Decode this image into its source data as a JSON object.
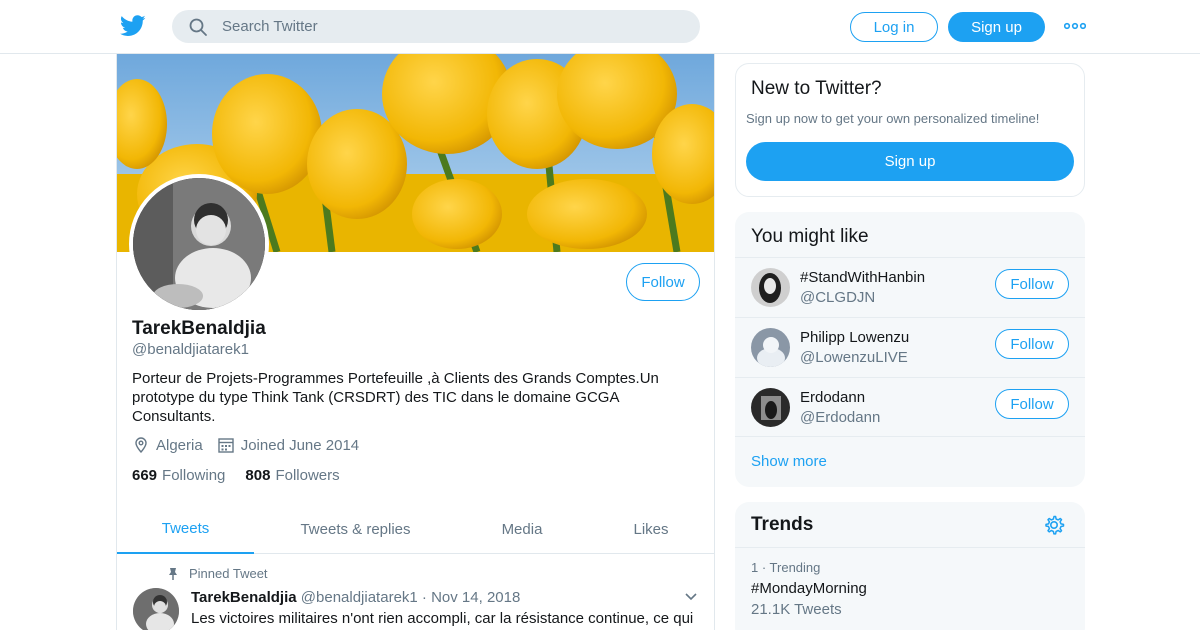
{
  "header": {
    "search_placeholder": "Search Twitter",
    "login_label": "Log in",
    "signup_label": "Sign up",
    "brand_color": "#1da1f2"
  },
  "profile": {
    "name": "TarekBenaldjia",
    "handle": "@benaldjiatarek1",
    "follow_label": "Follow",
    "bio": "Porteur de Projets-Programmes Portefeuille ,à Clients des Grands Comptes.Un prototype du type Think Tank (CRSDRT) des TIC dans le domaine GCGA Consultants.",
    "location": "Algeria",
    "joined": "Joined June 2014",
    "following_count": "669",
    "following_label": "Following",
    "followers_count": "808",
    "followers_label": "Followers",
    "tabs": [
      {
        "label": "Tweets",
        "active": true
      },
      {
        "label": "Tweets & replies",
        "active": false
      },
      {
        "label": "Media",
        "active": false
      },
      {
        "label": "Likes",
        "active": false
      }
    ]
  },
  "pinned_tweet": {
    "pinned_label": "Pinned Tweet",
    "author": "TarekBenaldjia",
    "handle": "@benaldjiatarek1",
    "separator": "·",
    "date": "Nov 14, 2018",
    "text": "Les victoires militaires n'ont rien accompli, car la résistance continue, ce qui"
  },
  "new_to_twitter": {
    "title": "New to Twitter?",
    "subtitle": "Sign up now to get your own personalized timeline!",
    "button": "Sign up"
  },
  "you_might_like": {
    "title": "You might like",
    "follow_label": "Follow",
    "items": [
      {
        "name": "#StandWithHanbin",
        "handle": "@CLGDJN"
      },
      {
        "name": "Philipp Lowenzu",
        "handle": "@LowenzuLIVE"
      },
      {
        "name": "Erdodann",
        "handle": "@Erdodann"
      }
    ],
    "show_more": "Show more"
  },
  "trends": {
    "title": "Trends",
    "items": [
      {
        "rank": "1 · Trending",
        "name": "#MondayMorning",
        "count": "21.1K Tweets"
      }
    ]
  }
}
